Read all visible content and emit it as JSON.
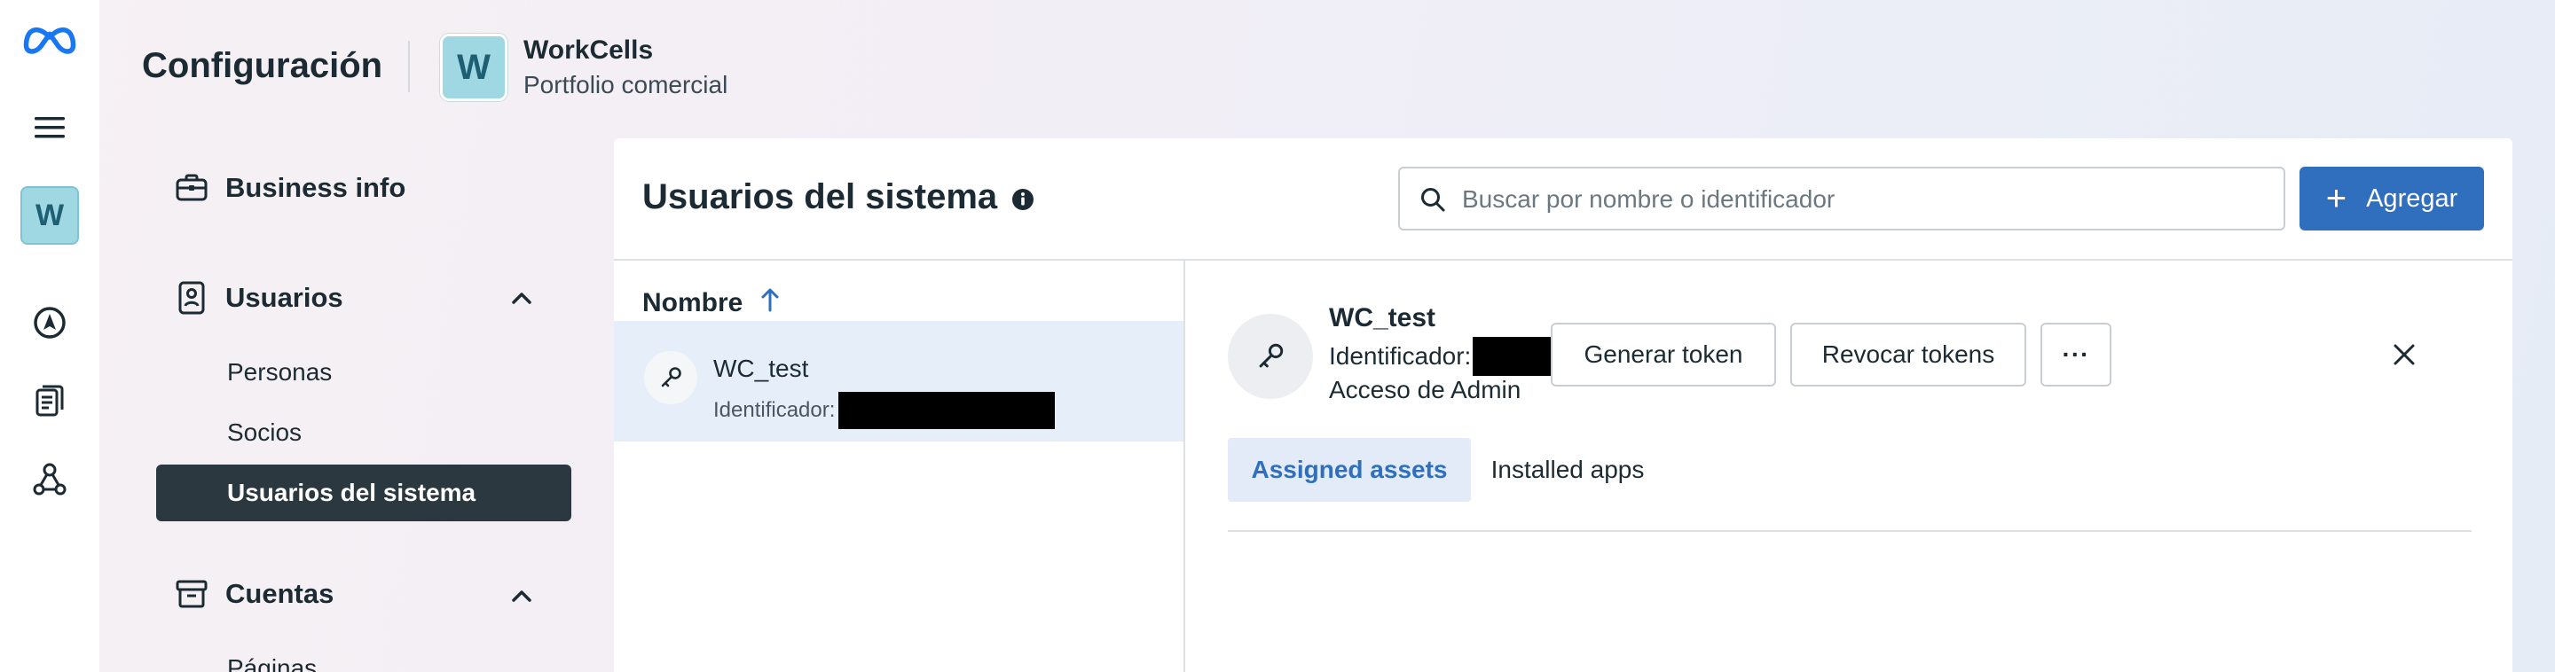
{
  "header": {
    "title": "Configuración",
    "portfolio_initial": "W",
    "portfolio_name": "WorkCells",
    "portfolio_type": "Portfolio comercial"
  },
  "rail": {
    "avatar_initial": "W",
    "icons": [
      "meta-logo-icon",
      "menu-icon",
      "compass-icon",
      "document-icon",
      "network-icon"
    ]
  },
  "sidebar": {
    "business_info": "Business info",
    "users_section": "Usuarios",
    "users_items": [
      "Personas",
      "Socios",
      "Usuarios del sistema"
    ],
    "active_item": "Usuarios del sistema",
    "accounts_section": "Cuentas",
    "accounts_items": [
      "Páginas"
    ]
  },
  "main": {
    "title": "Usuarios del sistema",
    "search_placeholder": "Buscar por nombre o identificador",
    "add_label": "Agregar",
    "column_header": "Nombre",
    "rows": [
      {
        "name": "WC_test",
        "id_label": "Identificador:"
      }
    ]
  },
  "detail": {
    "name": "WC_test",
    "id_label": "Identificador:",
    "access": "Acceso de Admin",
    "generate_token": "Generar token",
    "revoke_tokens": "Revocar tokens",
    "more_label": "···",
    "tabs": [
      "Assigned assets",
      "Installed apps"
    ],
    "active_tab": "Assigned assets"
  },
  "colors": {
    "accent": "#2f6fbd",
    "active_nav": "#2b3840",
    "selected_row": "#e6eefa",
    "avatar": "#9fd8e2"
  }
}
